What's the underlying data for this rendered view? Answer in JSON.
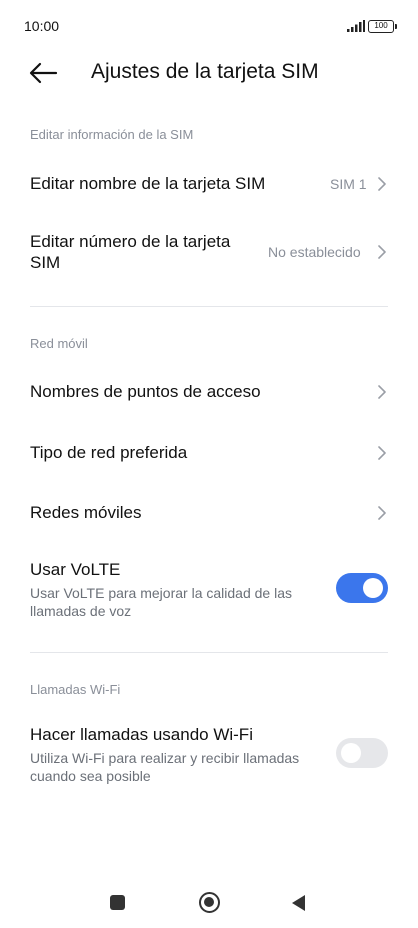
{
  "status_bar": {
    "time": "10:00",
    "battery": "100",
    "icons": [
      "signal-icon",
      "battery-icon"
    ]
  },
  "header": {
    "title": "Ajustes de la tarjeta SIM",
    "back_icon": "arrow-left-icon"
  },
  "sections": {
    "sim_info": {
      "label": "Editar información de la SIM",
      "edit_name": {
        "title": "Editar nombre de la tarjeta SIM",
        "value": "SIM 1"
      },
      "edit_number": {
        "title_line1": "Editar número de la tarjeta",
        "title_line2": "SIM",
        "value": "No establecido"
      }
    },
    "mobile_network": {
      "label": "Red móvil",
      "apn": {
        "title": "Nombres de puntos de acceso"
      },
      "network_type": {
        "title": "Tipo de red preferida"
      },
      "mobile_networks": {
        "title": "Redes móviles"
      },
      "volte": {
        "title": "Usar VoLTE",
        "desc_line1": "Usar VoLTE para mejorar la calidad de las",
        "desc_line2": "llamadas de voz",
        "enabled": true
      }
    },
    "wifi_calling": {
      "label": "Llamadas Wi-Fi",
      "wifi_call": {
        "title": "Hacer llamadas usando Wi-Fi",
        "desc_line1": "Utiliza Wi-Fi para realizar y recibir llamadas",
        "desc_line2": "cuando sea posible",
        "enabled": false
      }
    }
  },
  "colors": {
    "accent": "#3b76ec",
    "secondary_text": "#8a8f99",
    "toggle_off": "#e6e7ea"
  },
  "nav_bar": {
    "icons": [
      "recents-square-icon",
      "home-circle-icon",
      "back-triangle-icon"
    ]
  }
}
